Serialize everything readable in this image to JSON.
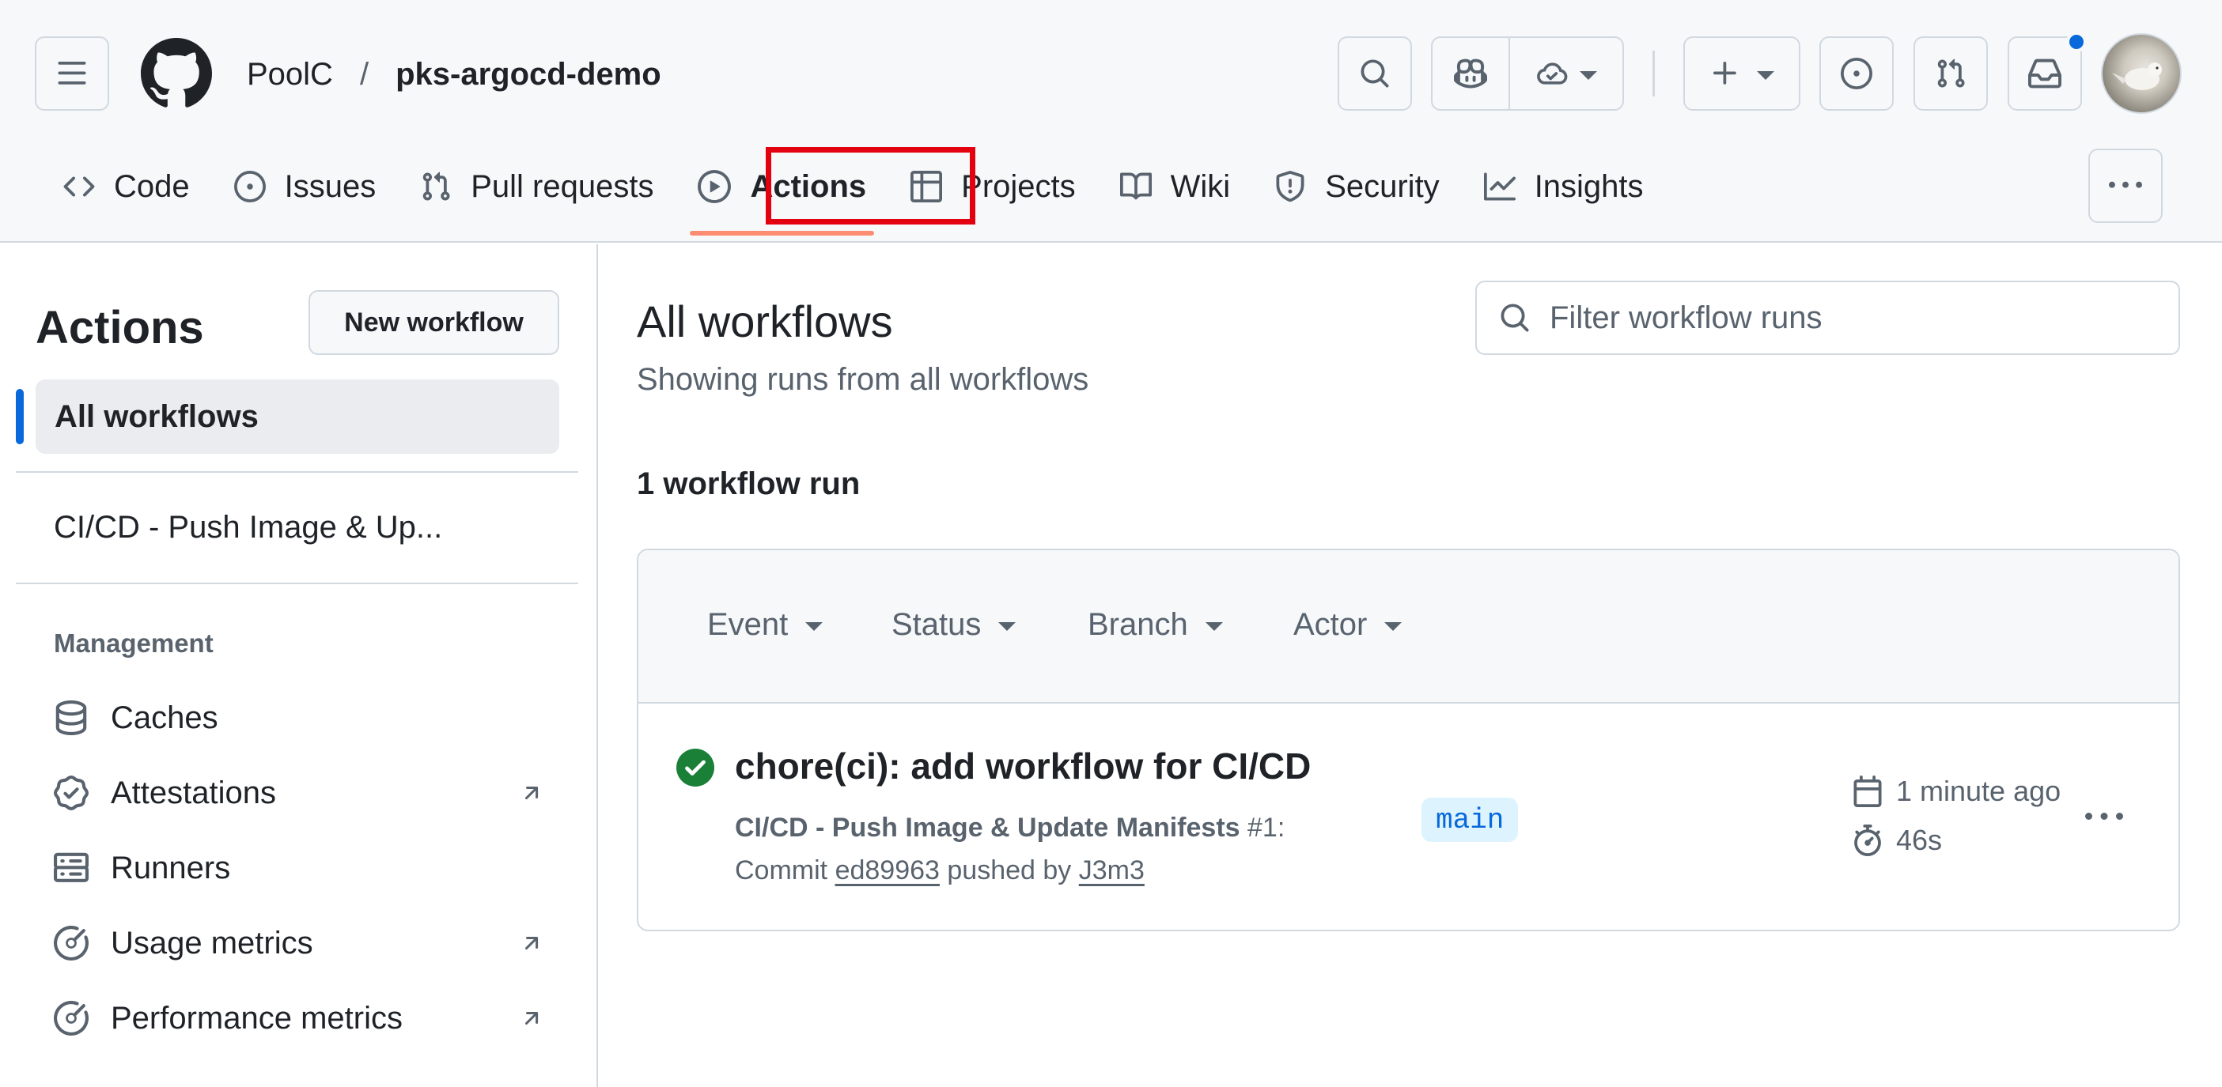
{
  "header": {
    "owner": "PoolC",
    "separator": "/",
    "repo": "pks-argocd-demo"
  },
  "repo_nav": {
    "items": [
      {
        "label": "Code",
        "icon": "code-icon"
      },
      {
        "label": "Issues",
        "icon": "issue-opened-icon"
      },
      {
        "label": "Pull requests",
        "icon": "git-pull-request-icon"
      },
      {
        "label": "Actions",
        "icon": "play-icon",
        "selected": true
      },
      {
        "label": "Projects",
        "icon": "table-icon"
      },
      {
        "label": "Wiki",
        "icon": "book-icon"
      },
      {
        "label": "Security",
        "icon": "shield-icon"
      },
      {
        "label": "Insights",
        "icon": "graph-icon"
      }
    ]
  },
  "sidebar": {
    "title": "Actions",
    "new_workflow": "New workflow",
    "all_workflows": "All workflows",
    "workflows": [
      "CI/CD - Push Image & Up..."
    ],
    "management_heading": "Management",
    "management_links": [
      {
        "label": "Caches",
        "icon": "database-icon",
        "external": false
      },
      {
        "label": "Attestations",
        "icon": "verified-icon",
        "external": true
      },
      {
        "label": "Runners",
        "icon": "server-icon",
        "external": false
      },
      {
        "label": "Usage metrics",
        "icon": "meter-icon",
        "external": true
      },
      {
        "label": "Performance metrics",
        "icon": "meter-icon",
        "external": true
      }
    ]
  },
  "main": {
    "title": "All workflows",
    "subtitle": "Showing runs from all workflows",
    "filter_placeholder": "Filter workflow runs",
    "run_count": "1 workflow run",
    "filters": [
      "Event",
      "Status",
      "Branch",
      "Actor"
    ],
    "runs": [
      {
        "title": "chore(ci): add workflow for CI/CD",
        "workflow_name": "CI/CD - Push Image & Update Manifests",
        "run_number": "#1:",
        "commit_prefix": "Commit",
        "commit_sha": "ed89963",
        "pushed_by_text": "pushed by",
        "actor": "J3m3",
        "branch": "main",
        "time_ago": "1 minute ago",
        "duration": "46s",
        "status": "success"
      }
    ]
  },
  "colors": {
    "accent": "#0969da",
    "success": "#1a7f37",
    "selected_underline": "#fd8c73",
    "annotation_box": "#e3000f"
  }
}
